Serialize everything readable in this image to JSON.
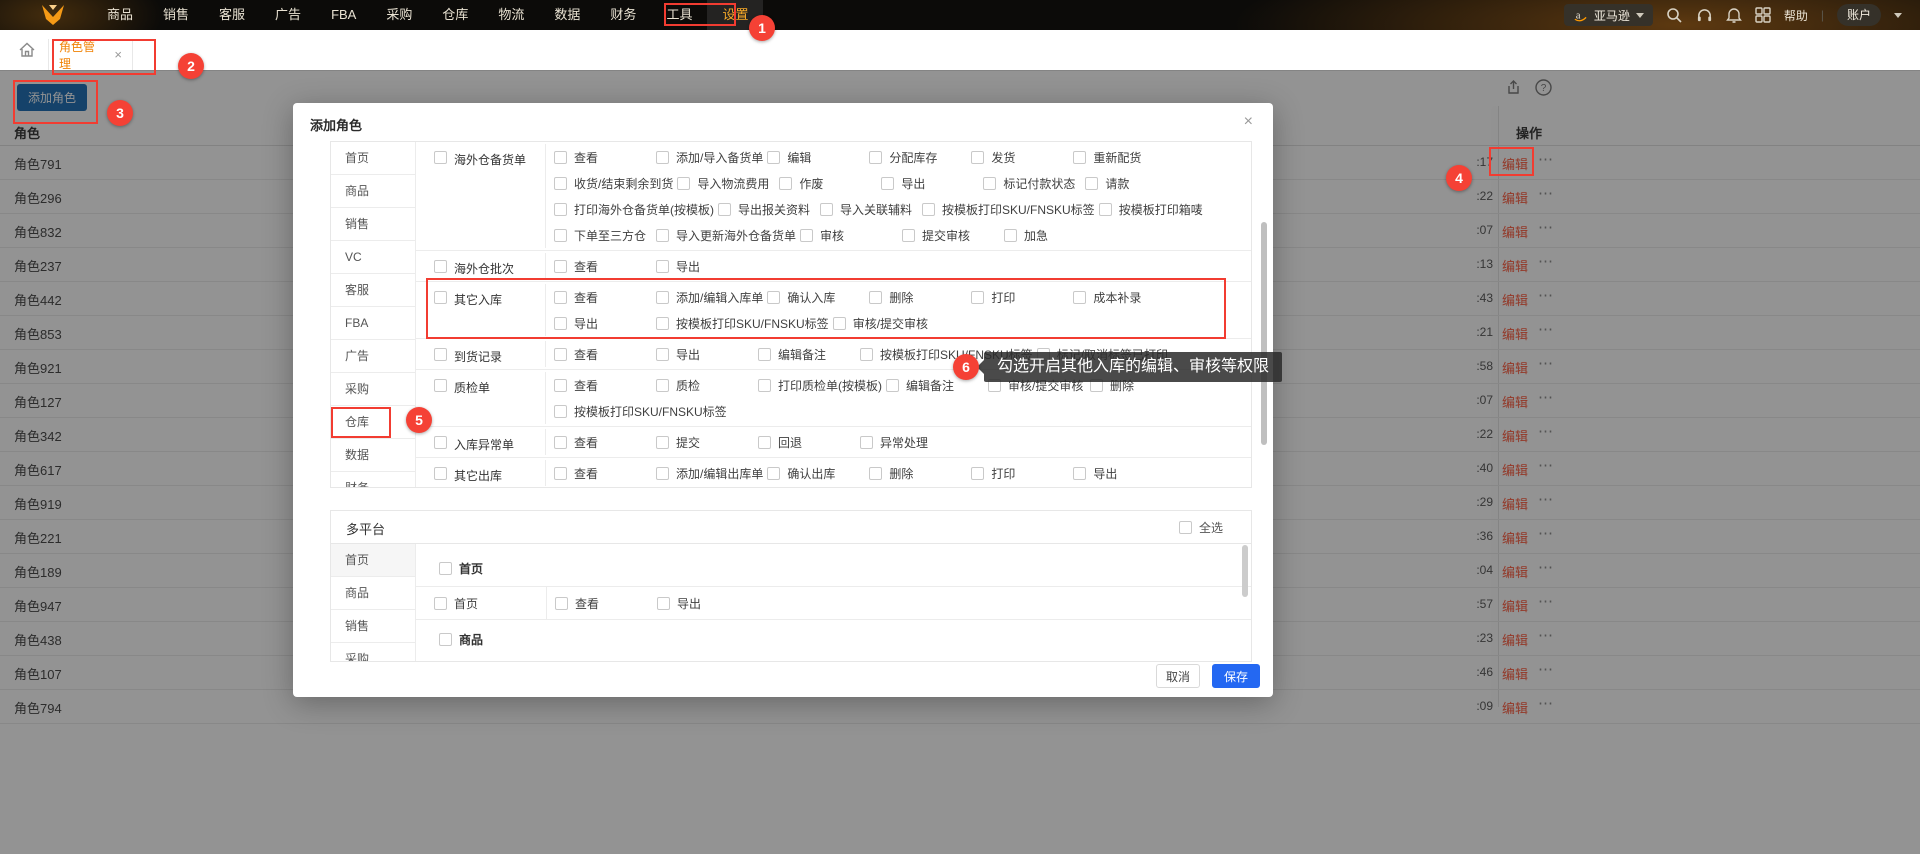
{
  "topnav": {
    "menu": [
      "商品",
      "销售",
      "客服",
      "广告",
      "FBA",
      "采购",
      "仓库",
      "物流",
      "数据",
      "财务",
      "工具",
      "设置"
    ],
    "active": "设置",
    "store_selector": "亚马逊",
    "help": "帮助",
    "account": "账户"
  },
  "tabbar": {
    "tab": "角色管理",
    "close": "×"
  },
  "page": {
    "add_role_button": "添加角色",
    "table": {
      "role_header": "角色",
      "action_header": "操作",
      "edit_label": "编辑",
      "more_label": "⋯",
      "rows": [
        {
          "name": "角色791",
          "time": ":17"
        },
        {
          "name": "角色296",
          "time": ":22"
        },
        {
          "name": "角色832",
          "time": ":07"
        },
        {
          "name": "角色237",
          "time": ":13"
        },
        {
          "name": "角色442",
          "time": ":43"
        },
        {
          "name": "角色853",
          "time": ":21"
        },
        {
          "name": "角色921",
          "time": ":58"
        },
        {
          "name": "角色127",
          "time": ":07"
        },
        {
          "name": "角色342",
          "time": ":22"
        },
        {
          "name": "角色617",
          "time": ":40"
        },
        {
          "name": "角色919",
          "time": ":29"
        },
        {
          "name": "角色221",
          "time": ":36"
        },
        {
          "name": "角色189",
          "time": ":04"
        },
        {
          "name": "角色947",
          "time": ":57"
        },
        {
          "name": "角色438",
          "time": ":23"
        },
        {
          "name": "角色107",
          "time": ":46"
        },
        {
          "name": "角色794",
          "time": ":09"
        }
      ]
    }
  },
  "modal": {
    "title": "添加角色",
    "close": "×",
    "warehouse_panel": {
      "sidebar": [
        "首页",
        "商品",
        "销售",
        "VC",
        "客服",
        "FBA",
        "广告",
        "采购",
        "仓库",
        "数据",
        "财务"
      ],
      "groups": [
        {
          "name": "海外仓备货单",
          "rows": [
            [
              "查看",
              "添加/导入备货单",
              "编辑",
              "分配库存",
              "发货",
              "重新配货"
            ],
            [
              "收货/结束剩余到货",
              "导入物流费用",
              "作废",
              "导出",
              "标记付款状态",
              "请款"
            ],
            [
              "打印海外仓备货单(按模板)",
              "导出报关资料",
              "导入关联辅料",
              "按模板打印SKU/FNSKU标签",
              "按模板打印箱唛"
            ],
            [
              "下单至三方仓",
              "导入更新海外仓备货单",
              "审核",
              "提交审核",
              "加急"
            ]
          ]
        },
        {
          "name": "海外仓批次",
          "rows": [
            [
              "查看",
              "导出"
            ]
          ]
        },
        {
          "name": "其它入库",
          "rows": [
            [
              "查看",
              "添加/编辑入库单",
              "确认入库",
              "删除",
              "打印",
              "成本补录"
            ],
            [
              "导出",
              "按模板打印SKU/FNSKU标签",
              "审核/提交审核"
            ]
          ]
        },
        {
          "name": "到货记录",
          "rows": [
            [
              "查看",
              "导出",
              "编辑备注",
              "按模板打印SKU/FNSKU标签",
              "标记/取消标签已打印"
            ]
          ]
        },
        {
          "name": "质检单",
          "rows": [
            [
              "查看",
              "质检",
              "打印质检单(按模板)",
              "编辑备注",
              "审核/提交审核",
              "删除"
            ],
            [
              "按模板打印SKU/FNSKU标签"
            ]
          ]
        },
        {
          "name": "入库异常单",
          "rows": [
            [
              "查看",
              "提交",
              "回退",
              "异常处理"
            ]
          ]
        },
        {
          "name": "其它出库",
          "rows": [
            [
              "查看",
              "添加/编辑出库单",
              "确认出库",
              "删除",
              "打印",
              "导出"
            ]
          ]
        }
      ]
    },
    "multi_panel": {
      "title": "多平台",
      "select_all": "全选",
      "sidebar": [
        "首页",
        "商品",
        "销售",
        "采购"
      ],
      "group_home": "首页",
      "home_row": {
        "name": "首页",
        "perms": [
          "查看",
          "导出"
        ]
      },
      "group_product": "商品"
    },
    "footer": {
      "cancel": "取消",
      "save": "保存"
    }
  },
  "annotations": {
    "badges": [
      "1",
      "2",
      "3",
      "4",
      "5",
      "6"
    ],
    "tooltip": "勾选开启其他入库的编辑、审核等权限"
  },
  "colors": {
    "nav_active_orange": "#f7a928",
    "annotation_red": "#f23c31",
    "save_blue": "#2468f2",
    "add_button_blue": "#1a6cb5",
    "edit_link": "#ff5a3c",
    "amazon_orange": "#ff9900"
  }
}
